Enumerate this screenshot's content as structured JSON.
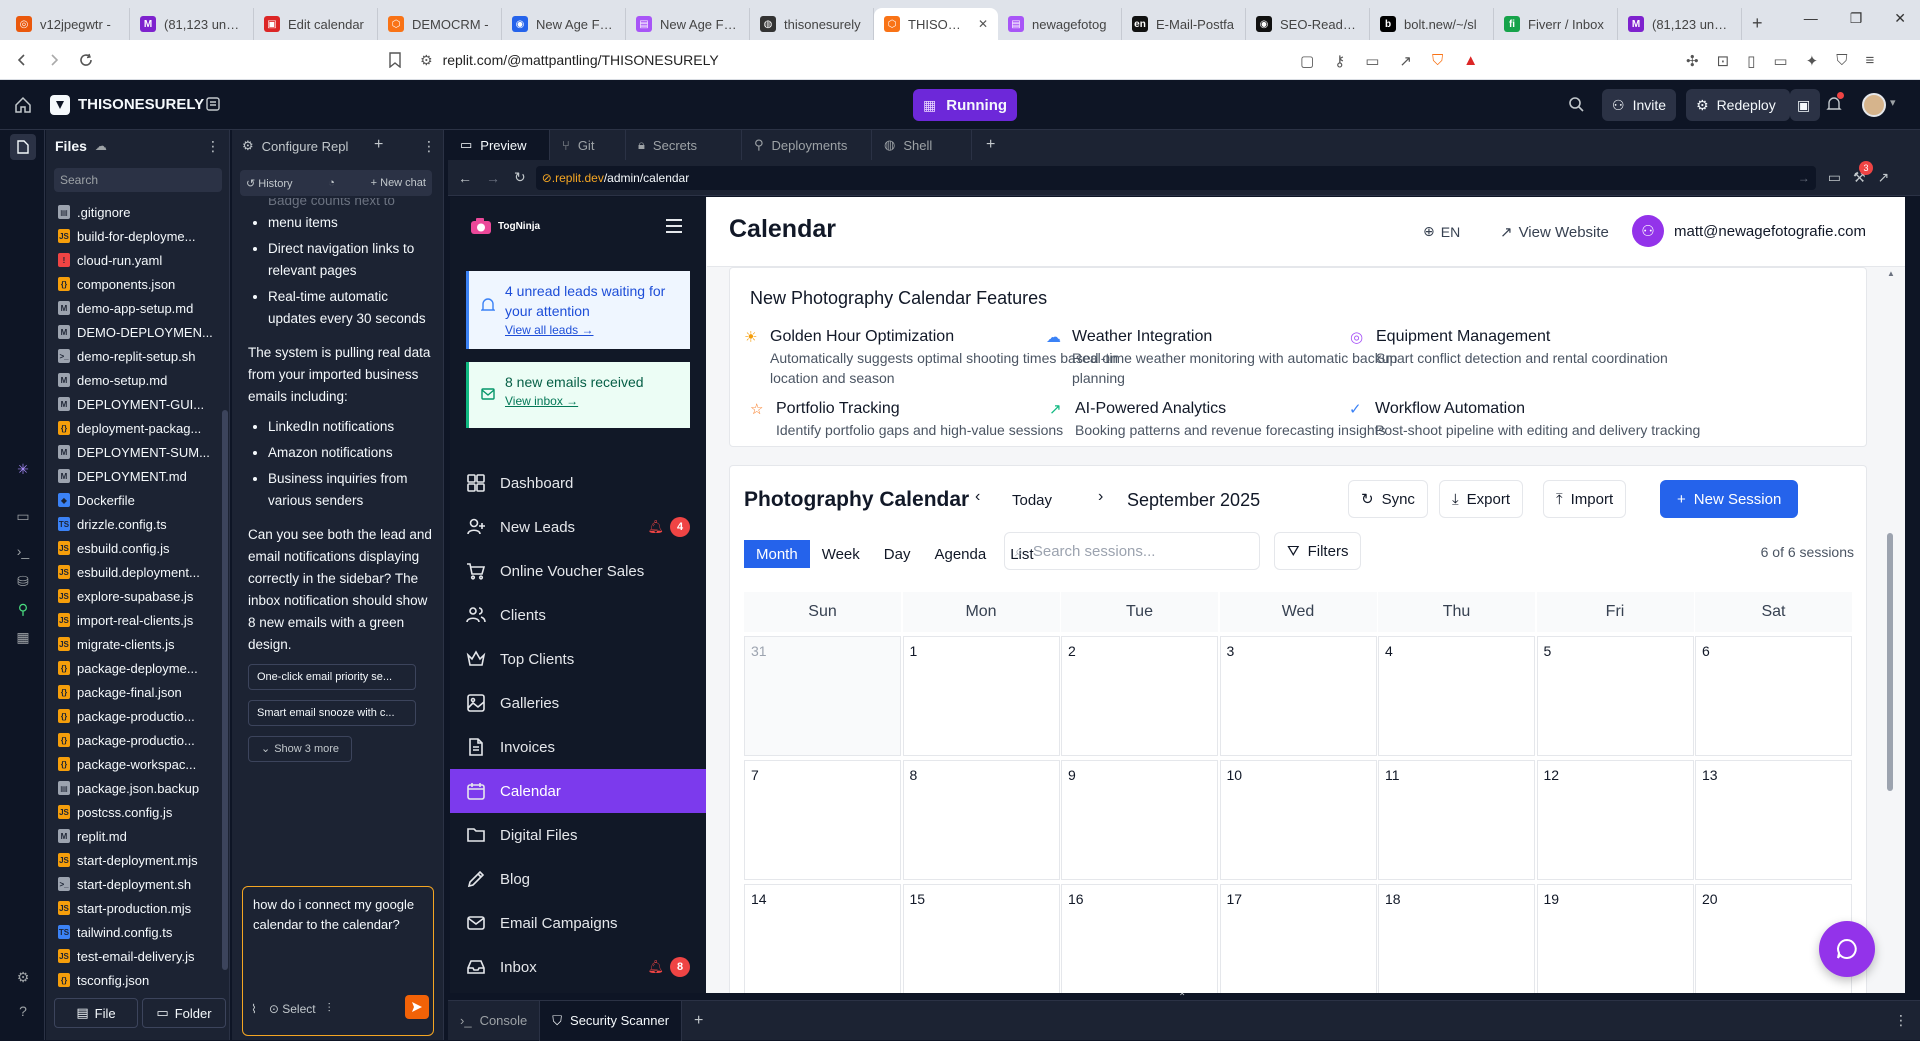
{
  "browser": {
    "tabs": [
      {
        "label": "v12jpegwtr -",
        "color": "#ea580c",
        "glyph": "◎"
      },
      {
        "label": "(81,123 unrea",
        "color": "#7e22ce",
        "glyph": "M"
      },
      {
        "label": "Edit calendar",
        "color": "#dc2626",
        "glyph": "▣"
      },
      {
        "label": "DEMOCRM -",
        "color": "#f97316",
        "glyph": "⬡"
      },
      {
        "label": "New Age Foto",
        "color": "#2563eb",
        "glyph": "◉"
      },
      {
        "label": "New Age Foto",
        "color": "#a855f7",
        "glyph": "▤"
      },
      {
        "label": "thisonesurely",
        "color": "#333333",
        "glyph": "◍"
      },
      {
        "label": "THISONES",
        "color": "#f97316",
        "glyph": "⬡"
      },
      {
        "label": "newagefotog",
        "color": "#a855f7",
        "glyph": "▤"
      },
      {
        "label": "E-Mail-Postfa",
        "color": "#111111",
        "glyph": "en"
      },
      {
        "label": "SEO-Ready C",
        "color": "#111111",
        "glyph": "◉"
      },
      {
        "label": "bolt.new/~/sl",
        "color": "#000000",
        "glyph": "b"
      },
      {
        "label": "Fiverr / Inbox",
        "color": "#16a34a",
        "glyph": "fi"
      },
      {
        "label": "(81,123 unrea",
        "color": "#7e22ce",
        "glyph": "M"
      }
    ],
    "url": "replit.com/@mattpantling/THISONESURELY"
  },
  "replit": {
    "project_name": "THISONESURELY",
    "run_status": "Running",
    "invite": "Invite",
    "redeploy": "Redeploy"
  },
  "files": {
    "title": "Files",
    "search_placeholder": "Search",
    "items": [
      {
        "name": ".gitignore",
        "color": "#9ca3af",
        "glyph": "▤"
      },
      {
        "name": "build-for-deployme...",
        "color": "#f59e0b",
        "glyph": "JS"
      },
      {
        "name": "cloud-run.yaml",
        "color": "#ef4444",
        "glyph": "!"
      },
      {
        "name": "components.json",
        "color": "#f59e0b",
        "glyph": "{}"
      },
      {
        "name": "demo-app-setup.md",
        "color": "#9ca3af",
        "glyph": "M"
      },
      {
        "name": "DEMO-DEPLOYMEN...",
        "color": "#9ca3af",
        "glyph": "M"
      },
      {
        "name": "demo-replit-setup.sh",
        "color": "#9ca3af",
        "glyph": ">_"
      },
      {
        "name": "demo-setup.md",
        "color": "#9ca3af",
        "glyph": "M"
      },
      {
        "name": "DEPLOYMENT-GUI...",
        "color": "#9ca3af",
        "glyph": "M"
      },
      {
        "name": "deployment-packag...",
        "color": "#f59e0b",
        "glyph": "{}"
      },
      {
        "name": "DEPLOYMENT-SUM...",
        "color": "#9ca3af",
        "glyph": "M"
      },
      {
        "name": "DEPLOYMENT.md",
        "color": "#9ca3af",
        "glyph": "M"
      },
      {
        "name": "Dockerfile",
        "color": "#3b82f6",
        "glyph": "◆"
      },
      {
        "name": "drizzle.config.ts",
        "color": "#3b82f6",
        "glyph": "TS"
      },
      {
        "name": "esbuild.config.js",
        "color": "#f59e0b",
        "glyph": "JS"
      },
      {
        "name": "esbuild.deployment...",
        "color": "#f59e0b",
        "glyph": "JS"
      },
      {
        "name": "explore-supabase.js",
        "color": "#f59e0b",
        "glyph": "JS"
      },
      {
        "name": "import-real-clients.js",
        "color": "#f59e0b",
        "glyph": "JS"
      },
      {
        "name": "migrate-clients.js",
        "color": "#f59e0b",
        "glyph": "JS"
      },
      {
        "name": "package-deployme...",
        "color": "#f59e0b",
        "glyph": "{}"
      },
      {
        "name": "package-final.json",
        "color": "#f59e0b",
        "glyph": "{}"
      },
      {
        "name": "package-productio...",
        "color": "#f59e0b",
        "glyph": "{}"
      },
      {
        "name": "package-productio...",
        "color": "#f59e0b",
        "glyph": "{}"
      },
      {
        "name": "package-workspac...",
        "color": "#f59e0b",
        "glyph": "{}"
      },
      {
        "name": "package.json.backup",
        "color": "#9ca3af",
        "glyph": "▤"
      },
      {
        "name": "postcss.config.js",
        "color": "#f59e0b",
        "glyph": "JS"
      },
      {
        "name": "replit.md",
        "color": "#9ca3af",
        "glyph": "M"
      },
      {
        "name": "start-deployment.mjs",
        "color": "#f59e0b",
        "glyph": "JS"
      },
      {
        "name": "start-deployment.sh",
        "color": "#9ca3af",
        "glyph": ">_"
      },
      {
        "name": "start-production.mjs",
        "color": "#f59e0b",
        "glyph": "JS"
      },
      {
        "name": "tailwind.config.ts",
        "color": "#3b82f6",
        "glyph": "TS"
      },
      {
        "name": "test-email-delivery.js",
        "color": "#f59e0b",
        "glyph": "JS"
      },
      {
        "name": "tsconfig.json",
        "color": "#f59e0b",
        "glyph": "{}"
      }
    ],
    "file_button": "File",
    "folder_button": "Folder"
  },
  "agent": {
    "tab_title": "Configure Repl",
    "history": "History",
    "new_chat": "New chat",
    "cut_line": "Badge counts next to",
    "bullets_top": [
      "menu items",
      "Direct navigation links to relevant pages",
      "Real-time automatic updates every 30 seconds"
    ],
    "para1": "The system is pulling real data from your imported business emails including:",
    "bullets_mid": [
      "LinkedIn notifications",
      "Amazon notifications",
      "Business inquiries from various senders"
    ],
    "para2": "Can you see both the lead and email notifications displaying correctly in the sidebar? The inbox notification should show 8 new emails with a green design.",
    "suggestions": [
      "One-click email priority se...",
      "Smart email snooze with c..."
    ],
    "show_more": "Show 3 more",
    "input_value": "how do i connect my google calendar to the calendar?",
    "select_label": "Select"
  },
  "workspace": {
    "tabs": [
      "Preview",
      "Git",
      "Secrets",
      "Deployments",
      "Shell"
    ],
    "preview_url_host": ".replit.dev",
    "preview_url_path": "/admin/calendar",
    "bottom_tabs": [
      "Console",
      "Security Scanner"
    ],
    "devtools_badge": "3"
  },
  "app": {
    "brand": "TogNinja",
    "leads_alert": {
      "text": "4 unread leads waiting for your attention",
      "link": "View all leads →"
    },
    "email_alert": {
      "text": "8 new emails received",
      "link": "View inbox →"
    },
    "nav": [
      {
        "label": "Dashboard",
        "icon": "dashboard-icon"
      },
      {
        "label": "New Leads",
        "icon": "user-plus-icon",
        "badge": "4"
      },
      {
        "label": "Online Voucher Sales",
        "icon": "cart-icon"
      },
      {
        "label": "Clients",
        "icon": "users-icon"
      },
      {
        "label": "Top Clients",
        "icon": "crown-icon"
      },
      {
        "label": "Galleries",
        "icon": "image-icon"
      },
      {
        "label": "Invoices",
        "icon": "file-icon"
      },
      {
        "label": "Calendar",
        "icon": "calendar-icon",
        "active": true
      },
      {
        "label": "Digital Files",
        "icon": "folder-icon"
      },
      {
        "label": "Blog",
        "icon": "pen-icon"
      },
      {
        "label": "Email Campaigns",
        "icon": "mail-icon"
      },
      {
        "label": "Inbox",
        "icon": "inbox-icon",
        "badge": "8"
      }
    ],
    "header": {
      "title": "Calendar",
      "lang": "EN",
      "view_website": "View Website",
      "user_email": "matt@newagefotografie.com"
    },
    "features": {
      "title": "New Photography Calendar Features",
      "items": [
        {
          "title": "Golden Hour Optimization",
          "desc": "Automatically suggests optimal shooting times based on location and season",
          "color": "#f59e0b"
        },
        {
          "title": "Weather Integration",
          "desc": "Real-time weather monitoring with automatic backup planning",
          "color": "#3b82f6"
        },
        {
          "title": "Equipment Management",
          "desc": "Smart conflict detection and rental coordination",
          "color": "#a855f7"
        },
        {
          "title": "Portfolio Tracking",
          "desc": "Identify portfolio gaps and high-value sessions",
          "color": "#f97316"
        },
        {
          "title": "AI-Powered Analytics",
          "desc": "Booking patterns and revenue forecasting insights",
          "color": "#10b981"
        },
        {
          "title": "Workflow Automation",
          "desc": "Post-shoot pipeline with editing and delivery tracking",
          "color": "#3b82f6"
        }
      ]
    },
    "calendar": {
      "title": "Photography Calendar",
      "today": "Today",
      "month_label": "September 2025",
      "sync": "Sync",
      "export": "Export",
      "import": "Import",
      "new_session": "New Session",
      "views": [
        "Month",
        "Week",
        "Day",
        "Agenda",
        "List"
      ],
      "active_view": "Month",
      "search_placeholder": "Search sessions...",
      "filters": "Filters",
      "count": "6 of 6 sessions",
      "weekdays": [
        "Sun",
        "Mon",
        "Tue",
        "Wed",
        "Thu",
        "Fri",
        "Sat"
      ],
      "weeks": [
        [
          "31",
          "1",
          "2",
          "3",
          "4",
          "5",
          "6"
        ],
        [
          "7",
          "8",
          "9",
          "10",
          "11",
          "12",
          "13"
        ],
        [
          "14",
          "15",
          "16",
          "17",
          "18",
          "19",
          "20"
        ]
      ]
    }
  }
}
